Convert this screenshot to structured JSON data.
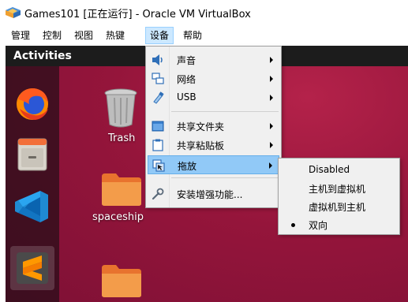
{
  "window": {
    "title": "Games101 [正在运行] - Oracle VM VirtualBox"
  },
  "menubar": {
    "items": [
      {
        "label": "管理"
      },
      {
        "label": "控制"
      },
      {
        "label": "视图"
      },
      {
        "label": "热键"
      },
      {
        "label": "设备",
        "active": true
      },
      {
        "label": "帮助"
      }
    ]
  },
  "guest": {
    "topbar": {
      "activities": "Activities"
    },
    "dock": {
      "apps": [
        {
          "name": "firefox",
          "icon": "firefox-icon"
        },
        {
          "name": "files",
          "icon": "file-cabinet-icon"
        },
        {
          "name": "vscode",
          "icon": "vscode-icon"
        },
        {
          "name": "sublime-text",
          "icon": "sublime-icon",
          "running": true
        }
      ]
    },
    "desktop": {
      "trash_label": "Trash",
      "folder_label": "spaceship"
    }
  },
  "devices_menu": {
    "items": [
      {
        "label": "声音",
        "icon": "speaker-icon",
        "submenu": true
      },
      {
        "label": "网络",
        "icon": "network-icon",
        "submenu": true
      },
      {
        "label": "USB",
        "icon": "usb-icon",
        "submenu": true
      },
      {
        "label": "共享文件夹",
        "icon": "shared-folder-icon",
        "submenu": true
      },
      {
        "label": "共享粘贴板",
        "icon": "clipboard-icon",
        "submenu": true
      },
      {
        "label": "拖放",
        "icon": "drag-drop-icon",
        "submenu": true,
        "highlighted": true
      },
      {
        "label": "安装增强功能...",
        "icon": "wrench-icon",
        "submenu": false
      }
    ]
  },
  "dragdrop_submenu": {
    "items": [
      {
        "label": "Disabled",
        "selected": false
      },
      {
        "label": "主机到虚拟机",
        "selected": false
      },
      {
        "label": "虚拟机到主机",
        "selected": false
      },
      {
        "label": "双向",
        "selected": true
      }
    ]
  },
  "colors": {
    "menu_highlight": "#91c9f7",
    "menubar_active": "#cce8ff",
    "ubuntu_bg": "#95153b"
  }
}
